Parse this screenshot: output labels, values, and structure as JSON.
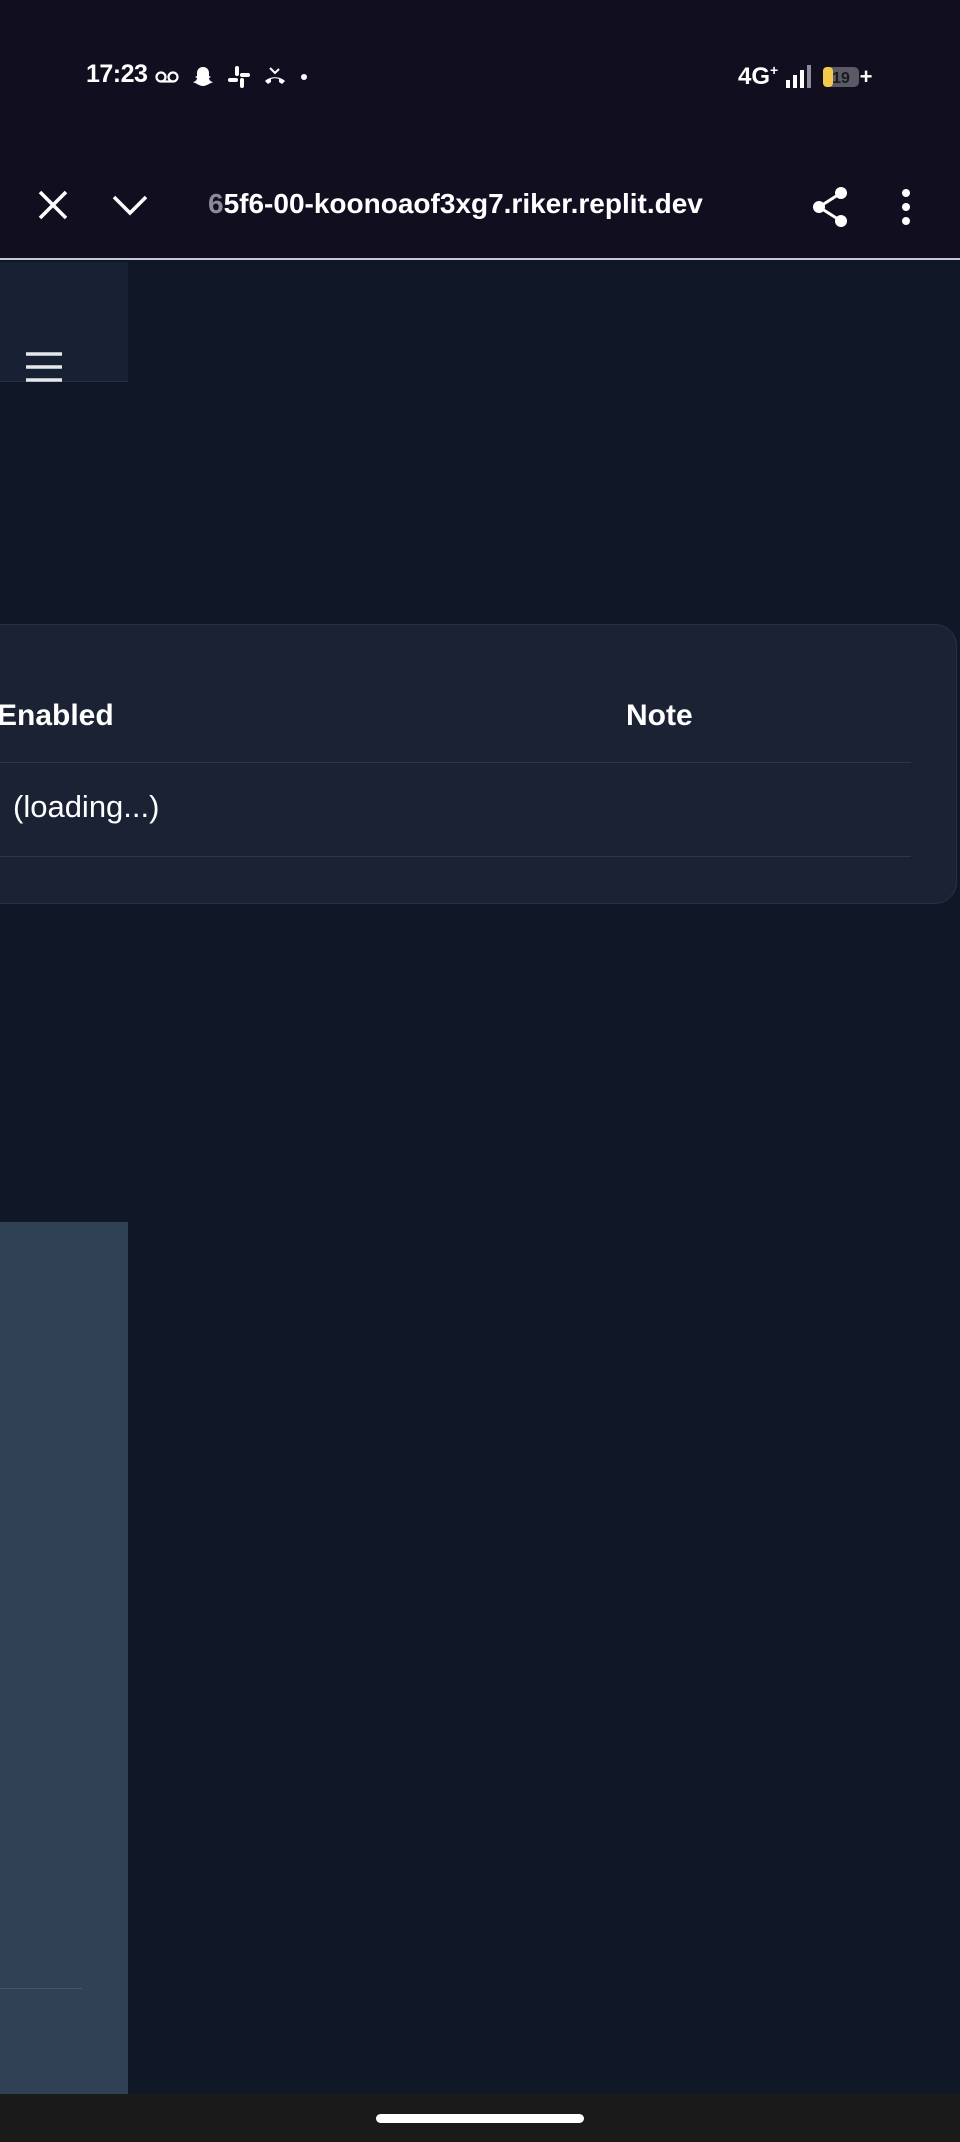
{
  "status_bar": {
    "time": "17:23",
    "network": "4G",
    "network_suffix": "+",
    "battery_level": "19",
    "battery_charging": "+",
    "left_icons": [
      "voicemail-icon",
      "snapchat-icon",
      "slack-icon",
      "missed-call-icon",
      "dot-icon"
    ]
  },
  "browser": {
    "url_prefix_faded": "6",
    "url": "5f6-00-koonoaof3xg7.riker.replit.dev"
  },
  "table": {
    "columns": [
      "Enabled",
      "Note"
    ],
    "rows": [
      {
        "enabled": "(loading...)",
        "note": ""
      }
    ]
  },
  "colors": {
    "status_bg": "#110e1f",
    "page_bg": "#101828",
    "card_bg": "#1a2234",
    "sidebar_bg": "#314155",
    "battery_yellow": "#f2c94c"
  }
}
